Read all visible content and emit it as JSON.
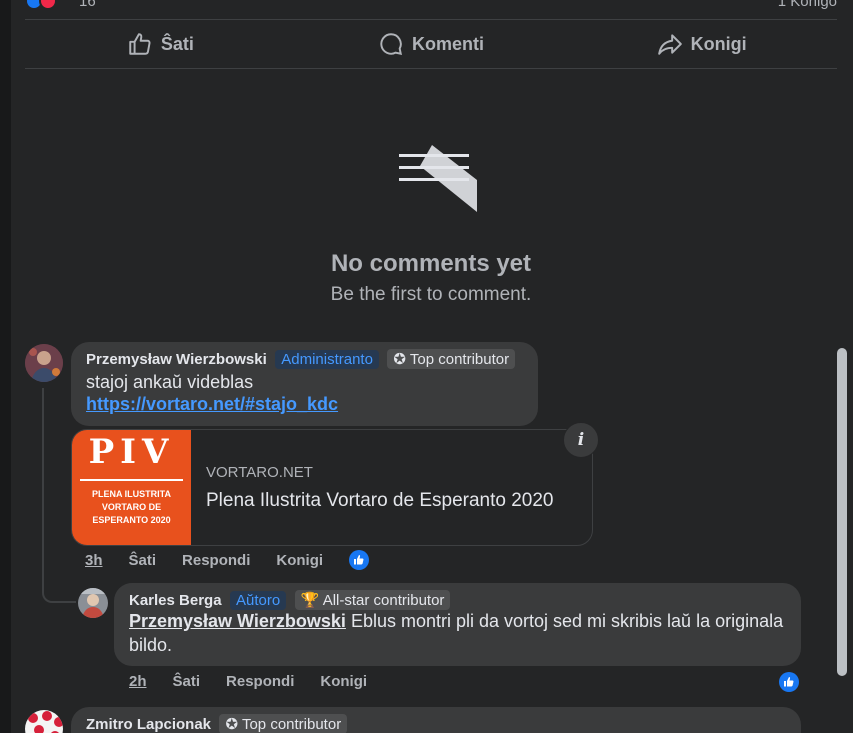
{
  "post": {
    "reaction_count": "16",
    "shares_label": "1 Konigo"
  },
  "actions": {
    "like_label": "Ŝati",
    "comment_label": "Komenti",
    "share_label": "Konigi"
  },
  "empty_state": {
    "title": "No comments yet",
    "subtitle": "Be the first to comment."
  },
  "comments": [
    {
      "author": "Przemysław Wierzbowski",
      "role": "Administranto",
      "badge": "Top contributor",
      "text": "stajoj ankaŭ videblas",
      "link": "https://vortaro.net/#stajo_kdc",
      "preview": {
        "thumb_title": "PIV",
        "thumb_caption": "PLENA ILUSTRITA VORTARO DE ESPERANTO 2020",
        "domain": "VORTARO.NET",
        "title": "Plena Ilustrita Vortaro de Esperanto 2020",
        "info_label": "i"
      },
      "time": "3h",
      "like": "Ŝati",
      "reply": "Respondi",
      "share": "Konigi"
    },
    {
      "author": "Karles Berga",
      "role": "Aŭtoro",
      "badge": "All-star contributor",
      "mention": "Przemysław Wierzbowski",
      "text": " Eblus montri pli da vortoj sed mi skribis laŭ la originala bildo.",
      "time": "2h",
      "like": "Ŝati",
      "reply": "Respondi",
      "share": "Konigi"
    },
    {
      "author": "Zmitro Lapcionak",
      "badge": "Top contributor"
    }
  ],
  "colors": {
    "panel": "#242526",
    "bubble": "#3a3b3c",
    "accent": "#4599ff",
    "like_blue": "#1877f2",
    "love_red": "#f02849"
  }
}
